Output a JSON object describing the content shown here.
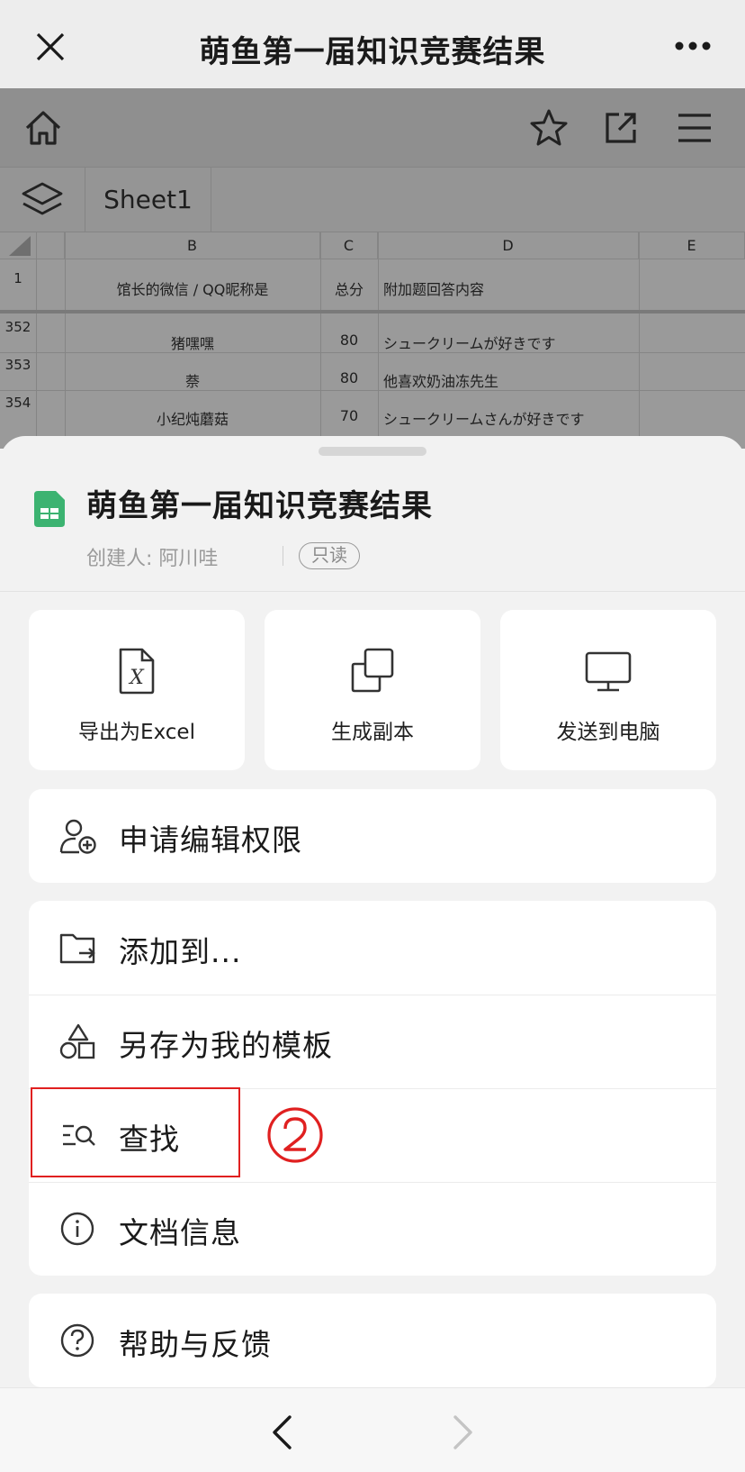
{
  "topnav": {
    "title": "萌鱼第一届知识竞赛结果"
  },
  "spreadsheet": {
    "sheet_tab": "Sheet1",
    "columns": [
      "B",
      "C",
      "D",
      "E"
    ],
    "header_row": {
      "num": "1",
      "b": "馆长的微信 / QQ昵称是",
      "c": "总分",
      "d": "附加题回答内容"
    },
    "rows": [
      {
        "num": "352",
        "b": "猪嘿嘿",
        "c": "80",
        "d": "シュークリームが好きです"
      },
      {
        "num": "353",
        "b": "萘",
        "c": "80",
        "d": "他喜欢奶油冻先生"
      },
      {
        "num": "354",
        "b": "小纪炖蘑菇",
        "c": "70",
        "d": "シュークリームさんが好きです"
      }
    ]
  },
  "panel": {
    "doc_title": "萌鱼第一届知识竞赛结果",
    "creator": "创建人:  阿川哇",
    "badge": "只读",
    "cards": [
      {
        "label": "导出为Excel",
        "icon": "excel-file-icon"
      },
      {
        "label": "生成副本",
        "icon": "copy-icon"
      },
      {
        "label": "发送到电脑",
        "icon": "monitor-icon"
      }
    ],
    "request_edit": {
      "label": "申请编辑权限",
      "icon": "user-add-icon"
    },
    "menu": [
      {
        "label": "添加到...",
        "icon": "folder-add-icon"
      },
      {
        "label": "另存为我的模板",
        "icon": "template-shapes-icon"
      },
      {
        "label": "查找",
        "icon": "search-list-icon"
      },
      {
        "label": "文档信息",
        "icon": "info-icon"
      }
    ],
    "help": {
      "label": "帮助与反馈",
      "icon": "help-icon"
    }
  },
  "annotation": {
    "marker": "②",
    "color": "#e02020"
  },
  "colors": {
    "accent_green": "#3cb371",
    "annotation_red": "#e02020"
  }
}
